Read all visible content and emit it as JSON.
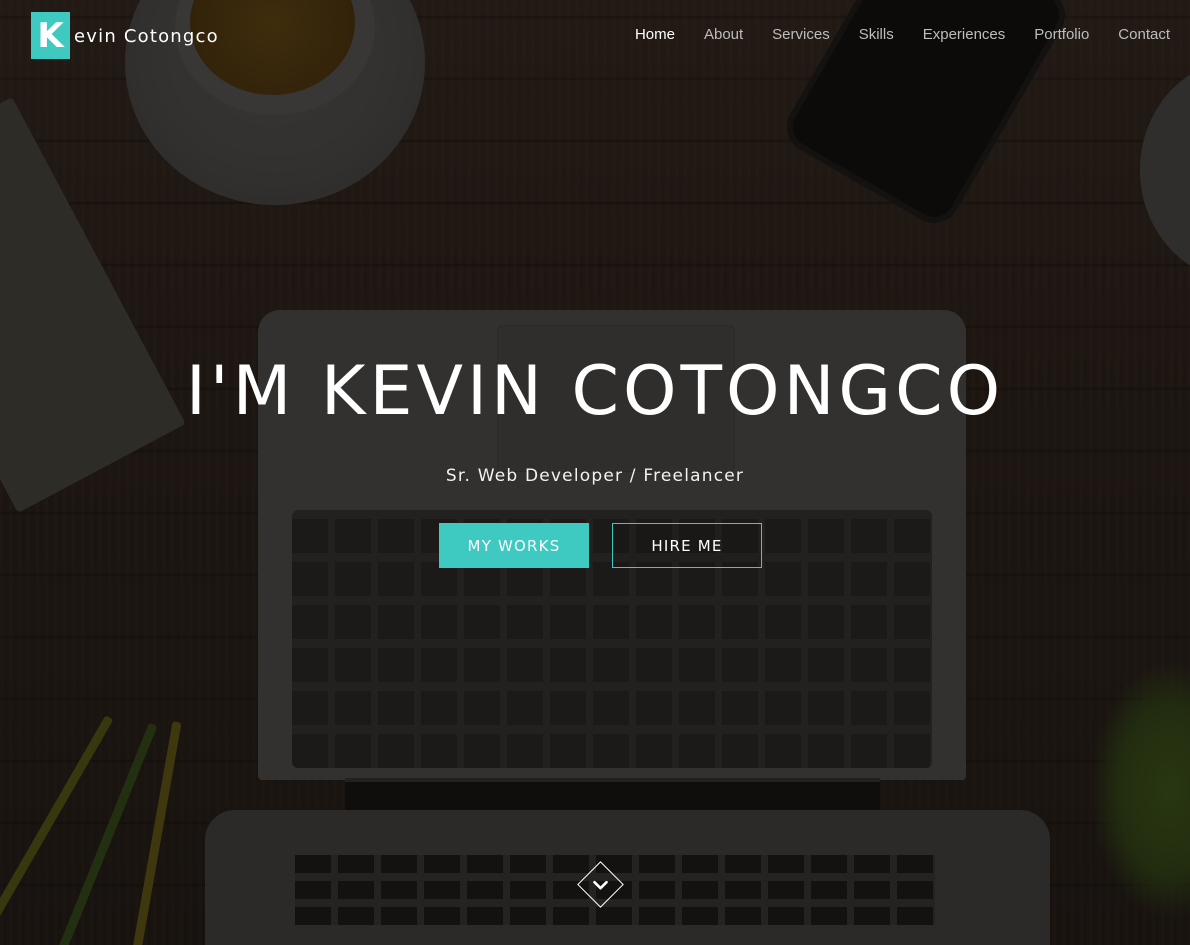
{
  "brand": {
    "initial": "K",
    "rest": "evin Cotongco",
    "accent_color": "#3ecac0"
  },
  "nav": {
    "items": [
      {
        "label": "Home",
        "active": true
      },
      {
        "label": "About",
        "active": false
      },
      {
        "label": "Services",
        "active": false
      },
      {
        "label": "Skills",
        "active": false
      },
      {
        "label": "Experiences",
        "active": false
      },
      {
        "label": "Portfolio",
        "active": false
      },
      {
        "label": "Contact",
        "active": false
      }
    ]
  },
  "hero": {
    "title": "I'M KEVIN COTONGCO",
    "subtitle": "Sr. Web Developer / Freelancer",
    "primary_button": "MY WORKS",
    "secondary_button": "HIRE ME",
    "scroll_icon": "chevron-down-icon"
  }
}
